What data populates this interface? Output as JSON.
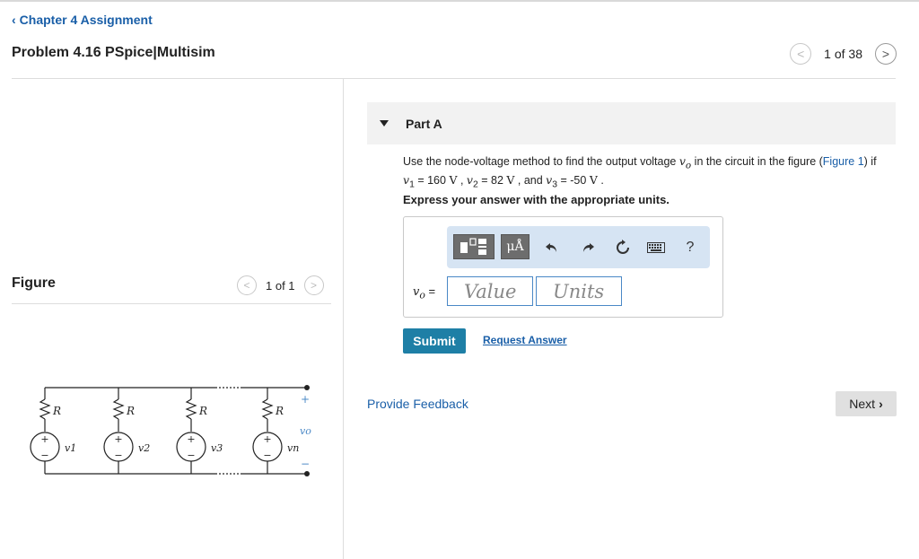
{
  "header": {
    "back_label": "Chapter 4 Assignment",
    "problem_title": "Problem 4.16 PSpice|Multisim",
    "counter": "1 of 38"
  },
  "figure_panel": {
    "label": "Figure",
    "counter": "1 of 1",
    "circuit": {
      "resistor_label": "R",
      "source_labels": [
        "v1",
        "v2",
        "v3",
        "vn"
      ],
      "output_label": "vo",
      "plus": "+",
      "minus": "−"
    }
  },
  "part": {
    "label": "Part A",
    "question_pre": "Use the node-voltage method to find the output voltage ",
    "var_vo": "v",
    "var_vo_sub": "o",
    "question_mid": " in the circuit in the figure (",
    "figure_link": "Figure 1",
    "question_after_link": ") if",
    "v1_sym": "v",
    "v1_sub": "1",
    "v1_eq": " = 160 ",
    "v1_unit": "V",
    "v2_sym": "v",
    "v2_sub": "2",
    "v2_eq": " = 82 ",
    "v2_unit": "V",
    "and_text": " , and ",
    "v3_sym": "v",
    "v3_sub": "3",
    "v3_eq": " = -50 ",
    "v3_unit": "V",
    "end": " .",
    "instruction": "Express your answer with the appropriate units."
  },
  "answer": {
    "label_var": "v",
    "label_sub": "o",
    "label_eq": " =",
    "value_placeholder": "Value",
    "units_placeholder": "Units",
    "toolbar": {
      "units_symbol": "μÅ",
      "help": "?"
    }
  },
  "actions": {
    "submit": "Submit",
    "request_answer": "Request Answer",
    "provide_feedback": "Provide Feedback",
    "next": "Next"
  }
}
